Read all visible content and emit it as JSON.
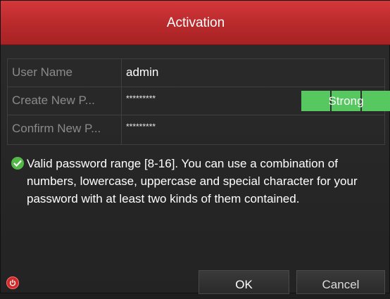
{
  "dialog": {
    "title": "Activation"
  },
  "form": {
    "user_name": {
      "label": "User Name",
      "value": "admin"
    },
    "create_password": {
      "label": "Create New P...",
      "value": "*********"
    },
    "confirm_password": {
      "label": "Confirm New P...",
      "value": "*********"
    },
    "strength": {
      "label": "Strong",
      "color": "#57c860"
    }
  },
  "hint": {
    "text": "Valid password range [8-16]. You can use a combination of numbers, lowercase, uppercase and special character for your password with at least two kinds of them contained."
  },
  "buttons": {
    "ok": "OK",
    "cancel": "Cancel"
  },
  "colors": {
    "title_bar": "#c0302f",
    "success": "#53b848",
    "power": "#d02a2a"
  }
}
